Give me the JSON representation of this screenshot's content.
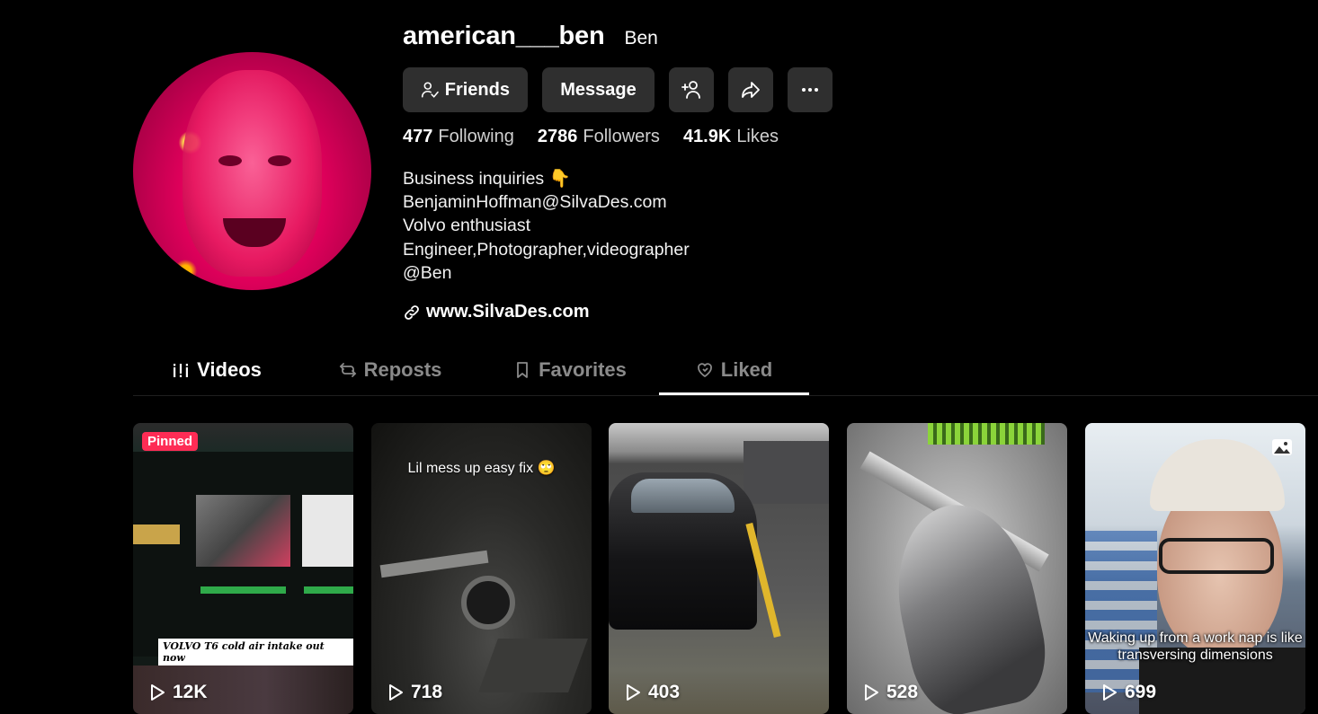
{
  "profile": {
    "username": "american___ben",
    "nickname": "Ben",
    "buttons": {
      "friends": "Friends",
      "message": "Message"
    },
    "stats": [
      {
        "value": "477",
        "label": "Following"
      },
      {
        "value": "2786",
        "label": "Followers"
      },
      {
        "value": "41.9K",
        "label": "Likes"
      }
    ],
    "bio": [
      "Business inquiries 👇",
      "BenjaminHoffman@SilvaDes.com",
      "Volvo enthusiast",
      "Engineer,Photographer,videographer",
      "@Ben"
    ],
    "link": "www.SilvaDes.com"
  },
  "tabs": [
    {
      "label": "Videos",
      "icon": "grid-lines-icon"
    },
    {
      "label": "Reposts",
      "icon": "repost-icon"
    },
    {
      "label": "Favorites",
      "icon": "bookmark-icon"
    },
    {
      "label": "Liked",
      "icon": "heart-outline-icon"
    }
  ],
  "active_tab": "Liked",
  "videos": [
    {
      "views": "12K",
      "pinned_label": "Pinned",
      "caption": "VOLVO T6 cold air intake out now"
    },
    {
      "views": "718",
      "caption": "Lil mess up easy fix 🙄"
    },
    {
      "views": "403"
    },
    {
      "views": "528"
    },
    {
      "views": "699",
      "caption": "Waking up from a work nap is like transversing dimensions",
      "icon": "photo-carousel-icon"
    }
  ]
}
